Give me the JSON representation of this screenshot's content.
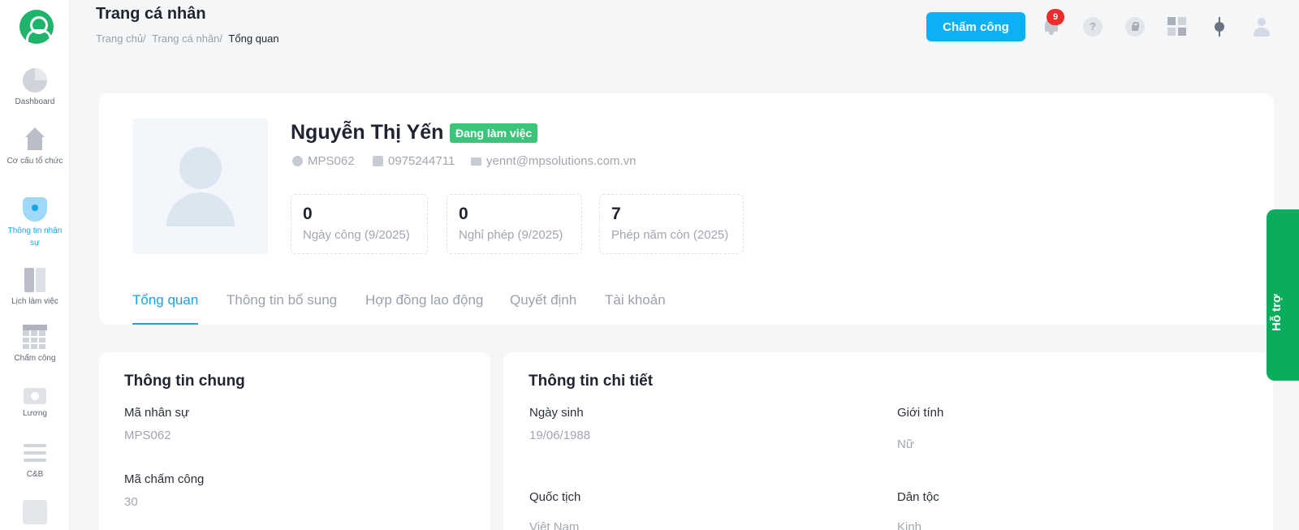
{
  "header": {
    "title": "Trang cá nhân",
    "breadcrumb": [
      "Trang chủ/",
      "Trang cá nhân/",
      "Tổng quan"
    ],
    "clock_in_button": "Chấm công",
    "notification_count": "9",
    "help_glyph": "?"
  },
  "sidebar": {
    "items": [
      {
        "label": "Dashboard",
        "icon": "pie-chart-icon"
      },
      {
        "label": "Cơ cấu tổ chức",
        "icon": "home-icon"
      },
      {
        "label": "Thông tin nhân sự",
        "icon": "shield-user-icon"
      },
      {
        "label": "Lịch làm việc",
        "icon": "book-icon"
      },
      {
        "label": "Chấm công",
        "icon": "calendar-grid-icon"
      },
      {
        "label": "Lương",
        "icon": "money-icon"
      },
      {
        "label": "C&B",
        "icon": "list-icon"
      }
    ]
  },
  "profile": {
    "name": "Nguyễn Thị Yến",
    "status": "Đang làm việc",
    "employee_code": "MPS062",
    "phone": "0975244711",
    "email": "yennt@mpsolutions.com.vn",
    "stats": [
      {
        "value": "0",
        "label": "Ngày công (9/2025)"
      },
      {
        "value": "0",
        "label": "Nghỉ phép (9/2025)"
      },
      {
        "value": "7",
        "label": "Phép năm còn (2025)"
      }
    ],
    "tabs": [
      "Tổng quan",
      "Thông tin bổ sung",
      "Hợp đồng lao động",
      "Quyết định",
      "Tài khoản"
    ]
  },
  "general_info": {
    "title": "Thông tin chung",
    "employee_code_label": "Mã nhân sự",
    "employee_code_value": "MPS062",
    "timekeeping_code_label": "Mã chấm công",
    "timekeeping_code_value": "30"
  },
  "detail_info": {
    "title": "Thông tin chi tiết",
    "dob_label": "Ngày sinh",
    "dob_value": "19/06/1988",
    "gender_label": "Giới tính",
    "gender_value": "Nữ",
    "nationality_label": "Quốc tịch",
    "nationality_value": "Việt Nam",
    "ethnicity_label": "Dân tộc",
    "ethnicity_value": "Kinh"
  },
  "support_label": "Hỗ trợ",
  "colors": {
    "primary": "#0bb0f5",
    "active": "#19a3e8",
    "status_green": "#3cc47b",
    "support_green": "#0aad5c",
    "badge_red": "#ee2b2b"
  }
}
